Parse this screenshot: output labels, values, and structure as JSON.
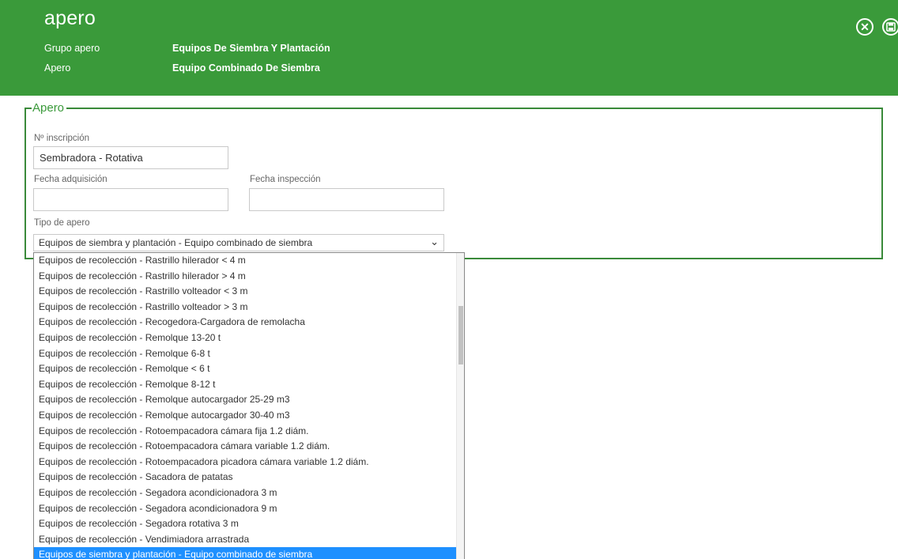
{
  "header": {
    "title": "apero",
    "rows": [
      {
        "label": "Grupo apero",
        "value": "Equipos De Siembra Y Plantación"
      },
      {
        "label": "Apero",
        "value": "Equipo Combinado De Siembra"
      }
    ],
    "icons": {
      "close": "close-circle-icon",
      "save": "save-circle-icon"
    },
    "background_color": "#3a9a3a"
  },
  "section": {
    "legend": "Apero",
    "border_color": "#3a8a3a",
    "fields": {
      "inscripcion": {
        "label": "Nº inscripción",
        "value": "Sembradora - Rotativa"
      },
      "fecha_adquisicion": {
        "label": "Fecha adquisición",
        "value": ""
      },
      "fecha_inspeccion": {
        "label": "Fecha inspección",
        "value": ""
      },
      "tipo_apero": {
        "label": "Tipo de apero",
        "value": "Equipos de siembra y plantación - Equipo combinado de siembra"
      }
    }
  },
  "dropdown": {
    "options": [
      "Equipos de recolección - Rastrillo hilerador < 4 m",
      "Equipos de recolección - Rastrillo hilerador > 4 m",
      "Equipos de recolección - Rastrillo volteador < 3 m",
      "Equipos de recolección - Rastrillo volteador > 3 m",
      "Equipos de recolección - Recogedora-Cargadora de remolacha",
      "Equipos de recolección - Remolque 13-20 t",
      "Equipos de recolección - Remolque 6-8 t",
      "Equipos de recolección - Remolque < 6 t",
      "Equipos de recolección - Remolque 8-12 t",
      "Equipos de recolección - Remolque autocargador 25-29 m3",
      "Equipos de recolección - Remolque autocargador 30-40 m3",
      "Equipos de recolección - Rotoempacadora cámara fija 1.2 diám.",
      "Equipos de recolección - Rotoempacadora cámara variable 1.2 diám.",
      "Equipos de recolección - Rotoempacadora picadora cámara variable 1.2 diám.",
      "Equipos de recolección - Sacadora de patatas",
      "Equipos de recolección - Segadora acondicionadora 3 m",
      "Equipos de recolección - Segadora acondicionadora 9 m",
      "Equipos de recolección - Segadora rotativa 3 m",
      "Equipos de recolección - Vendimiadora arrastrada",
      "Equipos de siembra y plantación - Equipo combinado de siembra"
    ],
    "selected_index": 19,
    "selected_color": "#1e90ff"
  }
}
